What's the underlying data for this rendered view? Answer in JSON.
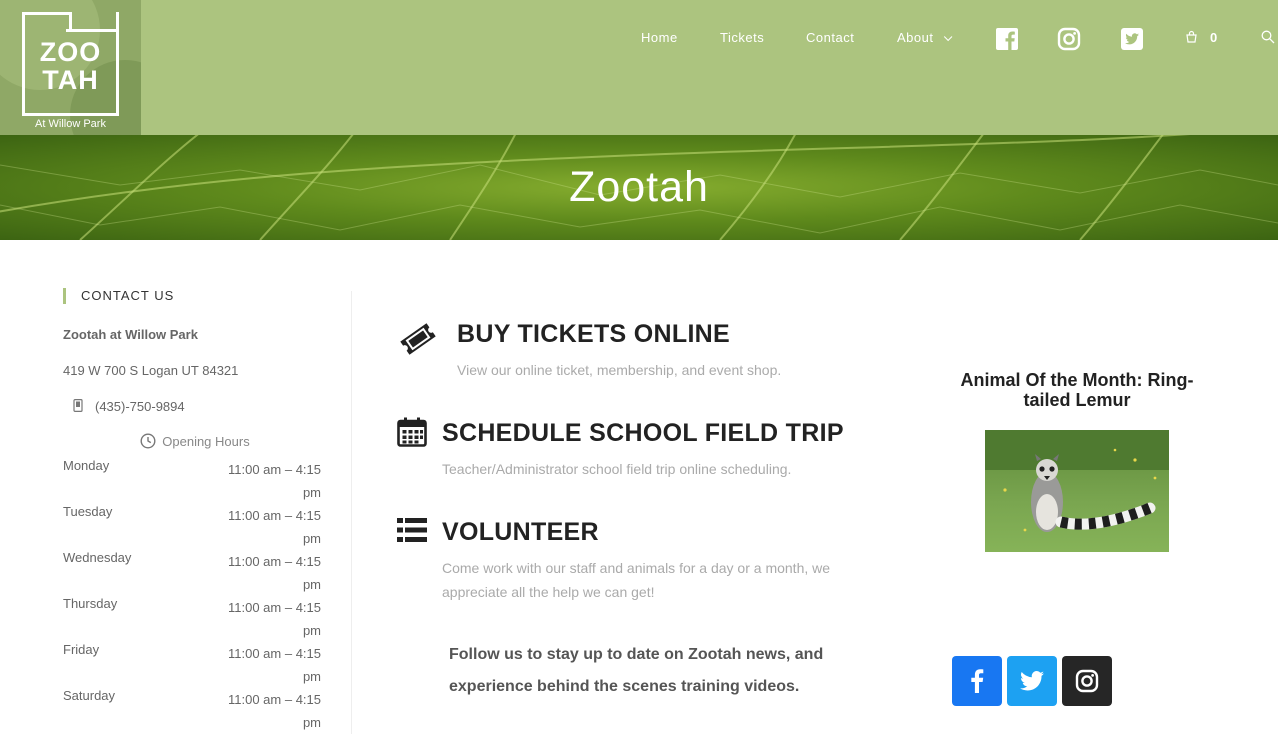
{
  "logo": {
    "line1": "ZOO",
    "line2": "TAH",
    "sub": "At Willow Park"
  },
  "nav": {
    "home": "Home",
    "tickets": "Tickets",
    "contact": "Contact",
    "about": "About"
  },
  "cart": {
    "count": "0"
  },
  "hero": {
    "title": "Zootah"
  },
  "sidebar": {
    "heading": "CONTACT US",
    "name": "Zootah at Willow Park",
    "address": "419 W 700 S Logan UT 84321",
    "phone": "(435)-750-9894",
    "hours_label": "Opening Hours",
    "hours": [
      {
        "day": "Monday",
        "time": "11:00 am – 4:15 pm"
      },
      {
        "day": "Tuesday",
        "time": "11:00 am – 4:15 pm"
      },
      {
        "day": "Wednesday",
        "time": "11:00 am – 4:15 pm"
      },
      {
        "day": "Thursday",
        "time": "11:00 am – 4:15 pm"
      },
      {
        "day": "Friday",
        "time": "11:00 am – 4:15 pm"
      },
      {
        "day": "Saturday",
        "time": "11:00 am – 4:15 pm"
      }
    ]
  },
  "features": {
    "tickets": {
      "title": "BUY TICKETS ONLINE",
      "desc": "View our online ticket, membership, and event shop."
    },
    "fieldtrip": {
      "title": "SCHEDULE SCHOOL FIELD TRIP",
      "desc": "Teacher/Administrator school field trip online scheduling."
    },
    "volunteer": {
      "title": "VOLUNTEER",
      "desc": "Come work with our staff and animals for a day or a month, we appreciate all the help we can get!"
    }
  },
  "follow": "Follow us to stay up to date on Zootah news, and experience behind the scenes training videos.",
  "animal_of_month": {
    "title": "Animal Of the Month: Ring-tailed Lemur"
  },
  "colors": {
    "header": "#acc47f",
    "facebook": "#1877f2",
    "twitter": "#1da1f2",
    "instagram": "#262626"
  }
}
